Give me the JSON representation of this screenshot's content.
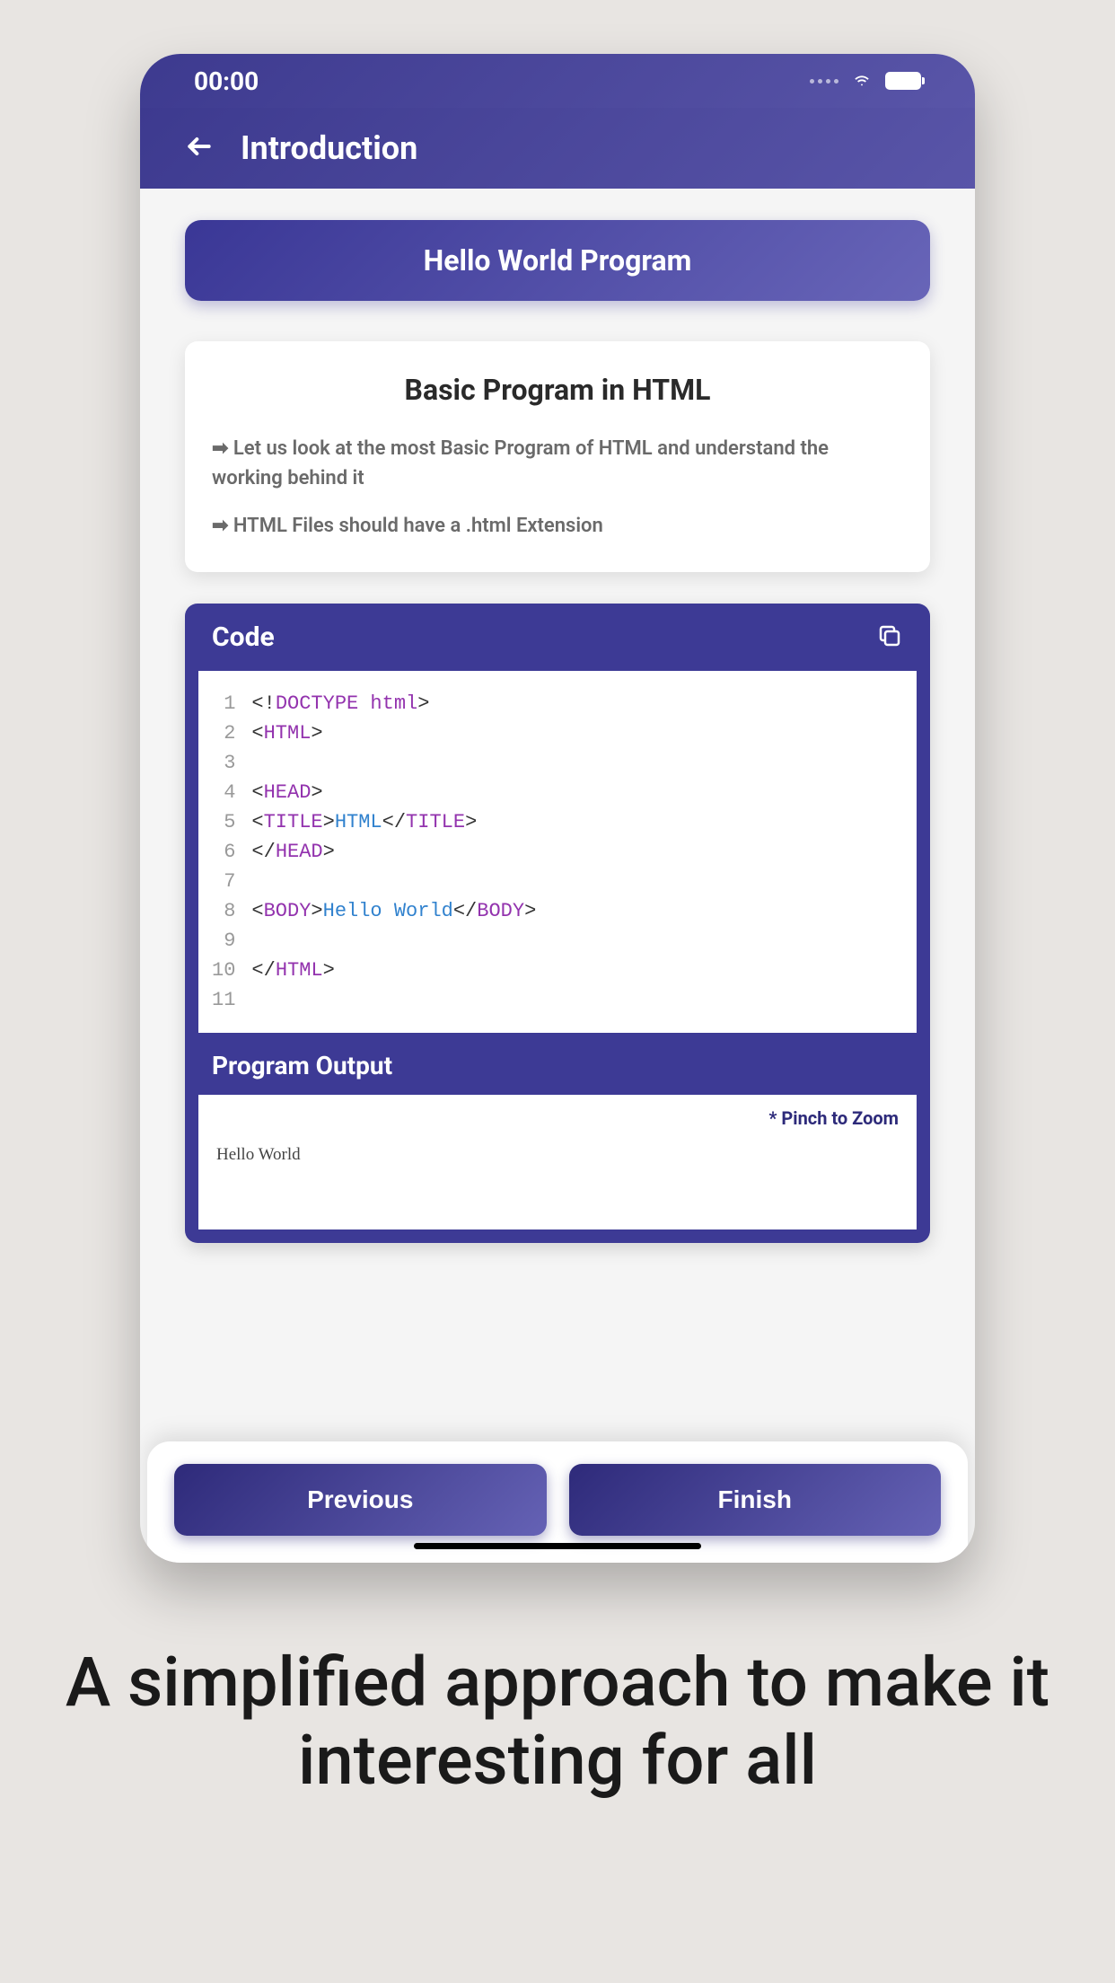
{
  "statusBar": {
    "time": "00:00"
  },
  "header": {
    "title": "Introduction"
  },
  "banner": {
    "title": "Hello World Program"
  },
  "infoCard": {
    "title": "Basic Program in HTML",
    "point1": "➡ Let us look at the most Basic Program of HTML and understand the working behind it",
    "point2": "➡ HTML Files should have a .html Extension"
  },
  "codeSection": {
    "label": "Code",
    "lineCount": 11,
    "lines": {
      "l1": {
        "p1": "<!",
        "p2": "DOCTYPE html",
        "p3": ">"
      },
      "l2": {
        "p1": "<",
        "p2": "HTML",
        "p3": ">"
      },
      "l4": {
        "p1": "<",
        "p2": "HEAD",
        "p3": ">"
      },
      "l5": {
        "p1": " <",
        "p2": "TITLE",
        "p3": ">",
        "p4": "HTML",
        "p5": "</",
        "p6": "TITLE",
        "p7": ">"
      },
      "l6": {
        "p1": "</",
        "p2": "HEAD",
        "p3": ">"
      },
      "l8": {
        "p1": "<",
        "p2": "BODY",
        "p3": ">",
        "p4": "Hello World",
        "p5": "</",
        "p6": "BODY",
        "p7": ">"
      },
      "l10": {
        "p1": "</",
        "p2": "HTML",
        "p3": ">"
      }
    }
  },
  "output": {
    "label": "Program Output",
    "zoomHint": "* Pinch to Zoom",
    "text": "Hello World"
  },
  "nav": {
    "previous": "Previous",
    "finish": "Finish"
  },
  "tagline": "A simplified approach to make it interesting for all"
}
